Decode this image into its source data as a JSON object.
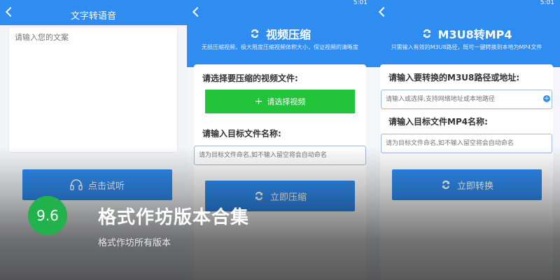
{
  "status_time": "5:01",
  "panel1": {
    "title": "文字转语音",
    "placeholder": "请输入您的文案",
    "listen_label": "点击试听"
  },
  "panel2": {
    "title": "视频压缩",
    "subtitle": "无损压缩视频，极大限度压缩视频体积大小，保证视频的清晰度",
    "select_label": "请选择要压缩的视频文件:",
    "select_button": "请选择视频",
    "target_label": "请输入目标文件名称:",
    "target_placeholder": "请为目标文件命名,如不输入留空将会自动命名",
    "action_button": "立即压缩"
  },
  "panel3": {
    "title": "M3U8转MP4",
    "subtitle": "只需输入有效的M3U8路径，既可一键转换到本地为MP4文件",
    "path_label": "请输入要转换的M3U8路径或地址:",
    "path_placeholder": "请输入或选择,支持网络地址或本地路径",
    "name_label": "请输入目标文件MP4名称:",
    "name_placeholder": "请为目标文件命名,如不输入留空将会自动命名",
    "action_button": "立即转换"
  },
  "overlay": {
    "rating": "9.6",
    "title": "格式作坊版本合集",
    "subtitle": "格式作坊所有版本"
  },
  "colors": {
    "primary": "#2f8cf0",
    "green": "#22c43a",
    "badge": "#22b24c"
  }
}
